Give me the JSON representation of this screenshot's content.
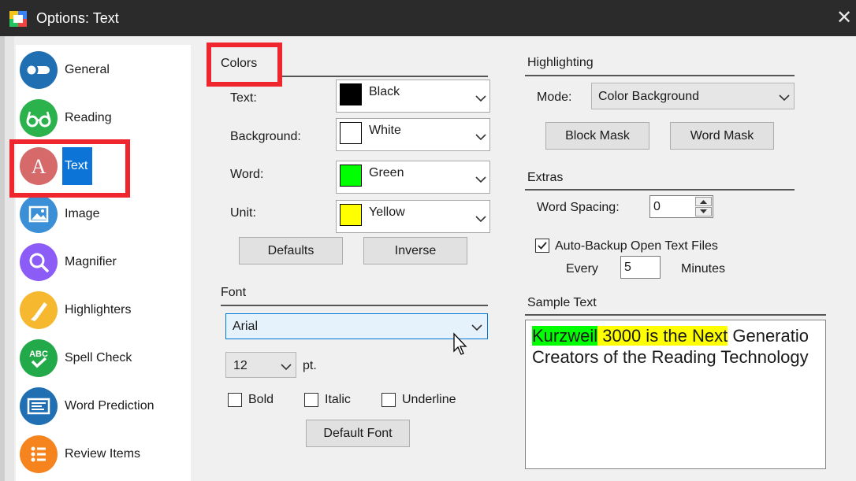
{
  "window": {
    "title": "Options: Text",
    "close_glyph": "✕"
  },
  "sidebar": {
    "items": [
      {
        "label": "General",
        "icon": "toggle-icon",
        "color": "#1f6fb2"
      },
      {
        "label": "Reading",
        "icon": "glasses-icon",
        "color": "#2bb24c"
      },
      {
        "label": "Text",
        "icon": "letter-a-icon",
        "color": "#d66a6a",
        "selected": true
      },
      {
        "label": "Image",
        "icon": "image-icon",
        "color": "#3a8fd6"
      },
      {
        "label": "Magnifier",
        "icon": "magnifier-icon",
        "color": "#8b5cf6"
      },
      {
        "label": "Highlighters",
        "icon": "highlighter-icon",
        "color": "#f5b82e"
      },
      {
        "label": "Spell Check",
        "icon": "spell-check-icon",
        "color": "#22a94a"
      },
      {
        "label": "Word Prediction",
        "icon": "word-prediction-icon",
        "color": "#1f6fb2"
      },
      {
        "label": "Review Items",
        "icon": "list-icon",
        "color": "#f5841f"
      }
    ]
  },
  "colors": {
    "heading": "Colors",
    "rows": [
      {
        "label": "Text:",
        "value": "Black",
        "swatch": "#000000"
      },
      {
        "label": "Background:",
        "value": "White",
        "swatch": "#ffffff"
      },
      {
        "label": "Word:",
        "value": "Green",
        "swatch": "#00ff00"
      },
      {
        "label": "Unit:",
        "value": "Yellow",
        "swatch": "#ffff00"
      }
    ],
    "defaults_button": "Defaults",
    "inverse_button": "Inverse"
  },
  "font": {
    "heading": "Font",
    "face": "Arial",
    "size": "12",
    "size_unit": "pt.",
    "bold": "Bold",
    "italic": "Italic",
    "underline": "Underline",
    "default_button": "Default Font"
  },
  "highlighting": {
    "heading": "Highlighting",
    "mode_label": "Mode:",
    "mode_value": "Color Background",
    "block_mask_button": "Block Mask",
    "word_mask_button": "Word Mask"
  },
  "extras": {
    "heading": "Extras",
    "word_spacing_label": "Word Spacing:",
    "word_spacing_value": "0",
    "auto_backup_label": "Auto-Backup Open Text Files",
    "auto_backup_checked": true,
    "every_label": "Every",
    "every_value": "5",
    "minutes_label": "Minutes"
  },
  "sample": {
    "heading": "Sample Text",
    "word": "Kurzweil",
    "unit": " 3000 is the Next",
    "rest_line1": " Generatio",
    "line2": "Creators of the Reading Technology",
    "word_color": "#00ff00",
    "unit_color": "#ffff00"
  }
}
